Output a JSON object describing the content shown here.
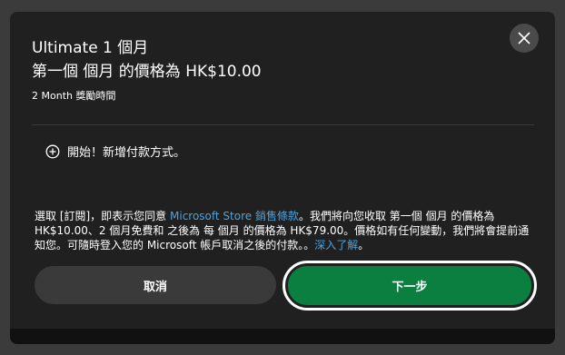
{
  "dialog": {
    "title": "Ultimate 1 個月",
    "subtitle": "第一個 個月 的價格為 HK$10.00",
    "trial": "2 Month 獎勵時間",
    "payment_label": "開始！新增付款方式。",
    "legal": {
      "part1": "選取 [訂閱]，即表示您同意 ",
      "terms_link": "Microsoft Store 銷售條款",
      "part2": "。我們將向您收取 第一個 個月 的價格為 HK$10.00、2 個月免費和 之後為 每 個月 的價格為 HK$79.00。價格如有任何變動，我們將會提前通知您。可隨時登入您的 Microsoft 帳戶取消之後的付款。。",
      "learn_more_link": "深入了解",
      "part3": "。"
    },
    "cancel_label": "取消",
    "next_label": "下一步"
  },
  "icons": {
    "close": "close-icon",
    "add": "plus-circle-icon"
  },
  "colors": {
    "accent_green": "#0a7f40",
    "link_blue": "#4aa3df",
    "dialog_bg": "#202020"
  }
}
